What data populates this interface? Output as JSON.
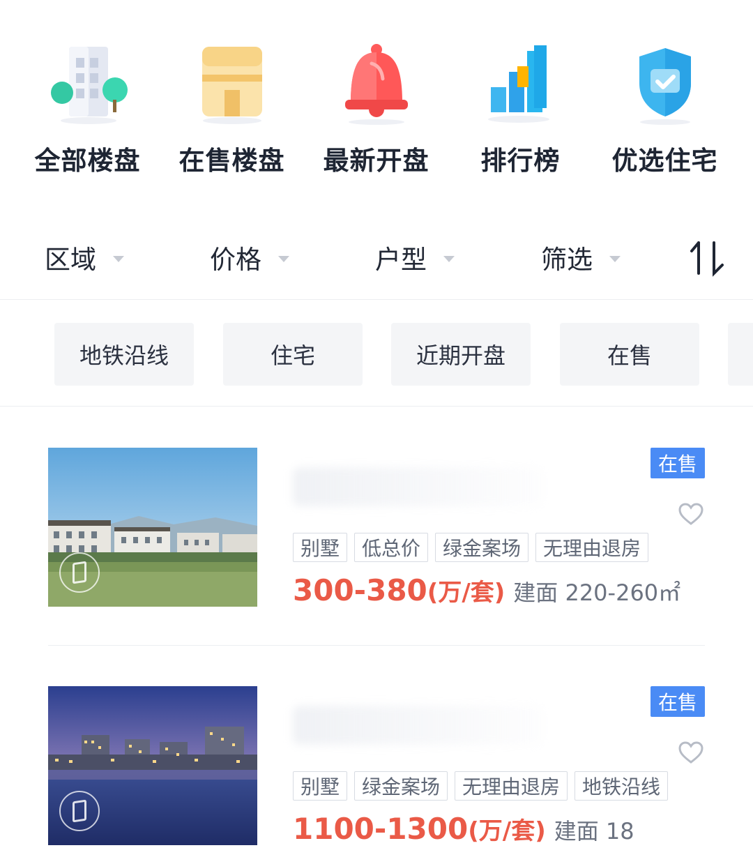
{
  "categories": [
    {
      "label": "全部楼盘",
      "icon": "building-icon"
    },
    {
      "label": "在售楼盘",
      "icon": "box-building-icon"
    },
    {
      "label": "最新开盘",
      "icon": "bell-icon"
    },
    {
      "label": "排行榜",
      "icon": "bar-chart-icon"
    },
    {
      "label": "优选住宅",
      "icon": "shield-check-icon"
    }
  ],
  "filters": [
    {
      "label": "区域"
    },
    {
      "label": "价格"
    },
    {
      "label": "户型"
    },
    {
      "label": "筛选"
    }
  ],
  "sort_icon": "sort-icon",
  "quick_tags": [
    "地铁沿线",
    "住宅",
    "近期开盘",
    "在售"
  ],
  "listings": [
    {
      "status": "在售",
      "tags": [
        "别墅",
        "低总价",
        "绿金案场",
        "无理由退房"
      ],
      "price": "300-380",
      "price_unit": "(万/套)",
      "area": "建面 220-260㎡"
    },
    {
      "status": "在售",
      "tags": [
        "别墅",
        "绿金案场",
        "无理由退房",
        "地铁沿线"
      ],
      "price": "1100-1300",
      "price_unit": "(万/套)",
      "area": "建面 18"
    }
  ],
  "colors": {
    "accent_blue": "#4a8bf5",
    "price_red": "#ea5a47",
    "tag_bg": "#f4f5f7"
  }
}
